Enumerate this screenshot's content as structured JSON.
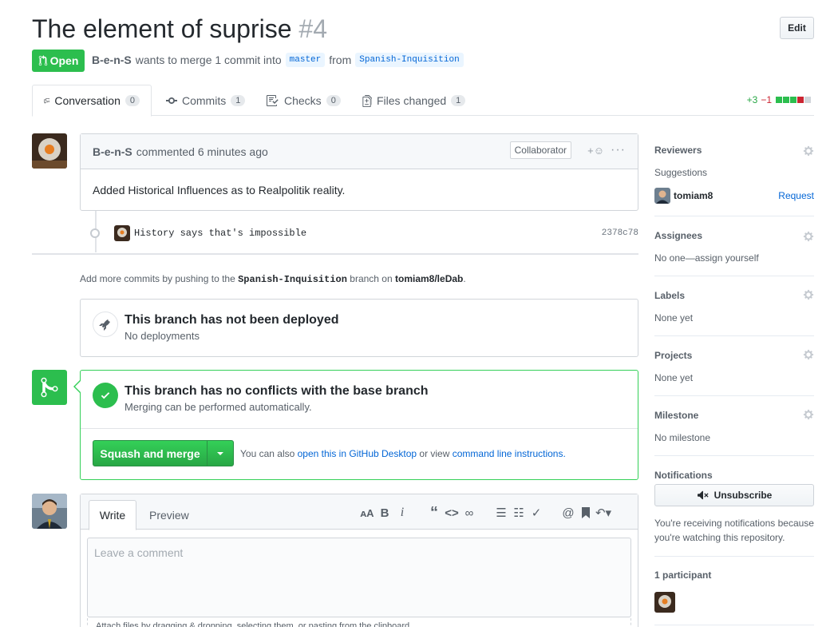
{
  "header": {
    "title": "The element of suprise",
    "number": "#4",
    "edit_label": "Edit",
    "state_label": "Open",
    "author": "B-e-n-S",
    "merge_text": "wants to merge 1 commit into",
    "base_branch": "master",
    "from_text": "from",
    "head_branch": "Spanish-Inquisition"
  },
  "tabs": [
    {
      "label": "Conversation",
      "count": "0"
    },
    {
      "label": "Commits",
      "count": "1"
    },
    {
      "label": "Checks",
      "count": "0"
    },
    {
      "label": "Files changed",
      "count": "1"
    }
  ],
  "diffstat": {
    "additions": "+3",
    "deletions": "−1"
  },
  "comment": {
    "author": "B-e-n-S",
    "time": "commented 6 minutes ago",
    "label": "Collaborator",
    "body": "Added Historical Influences as to Realpolitik reality."
  },
  "commit": {
    "message": "History says that's impossible",
    "sha": "2378c78"
  },
  "push_help": {
    "prefix": "Add more commits by pushing to the",
    "branch": "Spanish-Inquisition",
    "middle": "branch on",
    "repo": "tomiam8/leDab",
    "suffix": "."
  },
  "deploy": {
    "title": "This branch has not been deployed",
    "subtitle": "No deployments"
  },
  "merge": {
    "title": "This branch has no conflicts with the base branch",
    "subtitle": "Merging can be performed automatically.",
    "button_label": "Squash and merge",
    "help_prefix": "You can also",
    "desktop_link": "open this in GitHub Desktop",
    "help_middle": "or view",
    "cli_link": "command line instructions",
    "help_suffix": "."
  },
  "composer": {
    "write_tab": "Write",
    "preview_tab": "Preview",
    "placeholder": "Leave a comment",
    "attach_hint": "Attach files by dragging & dropping, selecting them, or pasting from the clipboard."
  },
  "sidebar": {
    "reviewers": {
      "heading": "Reviewers",
      "suggestions": "Suggestions",
      "suggested_user": "tomiam8",
      "request": "Request"
    },
    "assignees": {
      "heading": "Assignees",
      "text": "No one—assign yourself"
    },
    "labels": {
      "heading": "Labels",
      "text": "None yet"
    },
    "projects": {
      "heading": "Projects",
      "text": "None yet"
    },
    "milestone": {
      "heading": "Milestone",
      "text": "No milestone"
    },
    "notifications": {
      "heading": "Notifications",
      "button": "Unsubscribe",
      "text": "You're receiving notifications because you're watching this repository."
    },
    "participants": {
      "heading": "1 participant"
    }
  },
  "colors": {
    "green": "#2cbe4e",
    "link": "#0366d6",
    "deletion": "#cb2431"
  }
}
